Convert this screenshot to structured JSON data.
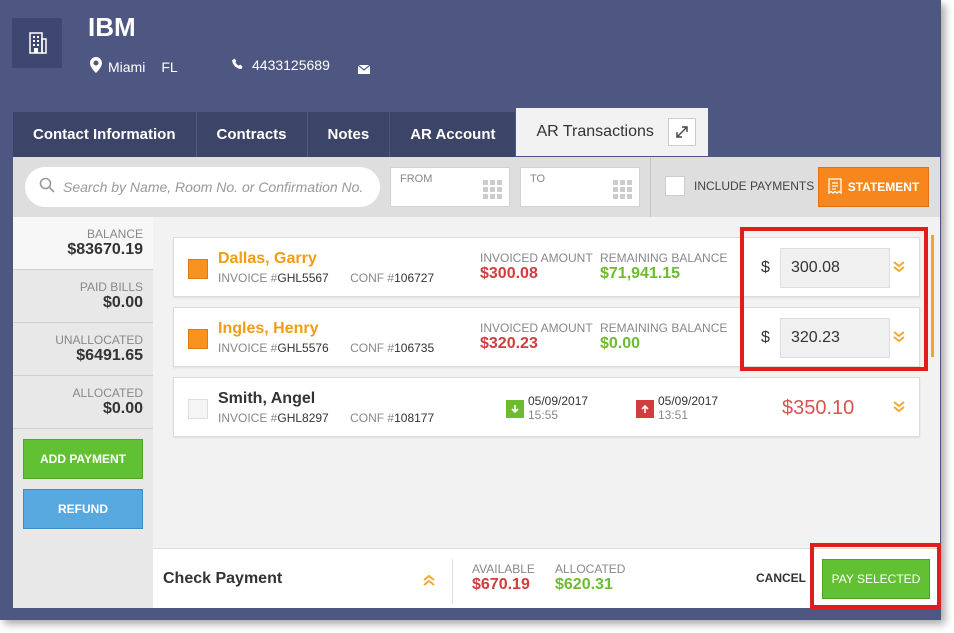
{
  "header": {
    "company": "IBM",
    "city": "Miami",
    "state": "FL",
    "phone": "4433125689",
    "icons": {
      "company": "building-icon",
      "location": "map-pin-icon",
      "phone": "phone-icon",
      "email": "envelope-icon"
    }
  },
  "tabs": [
    {
      "label": "Contact Information",
      "active": false
    },
    {
      "label": "Contracts",
      "active": false
    },
    {
      "label": "Notes",
      "active": false
    },
    {
      "label": "AR Account",
      "active": false
    },
    {
      "label": "AR Transactions",
      "active": true
    }
  ],
  "filters": {
    "search_placeholder": "Search by Name, Room No. or Confirmation No.",
    "from_label": "FROM",
    "to_label": "TO",
    "include_payments_label": "INCLUDE PAYMENTS",
    "include_payments_checked": false,
    "statement_label": "STATEMENT"
  },
  "sidebar": {
    "balance": {
      "label": "BALANCE",
      "value": "$83670.19"
    },
    "paid_bills": {
      "label": "PAID BILLS",
      "value": "$0.00"
    },
    "unallocated": {
      "label": "UNALLOCATED",
      "value": "$6491.65"
    },
    "allocated": {
      "label": "ALLOCATED",
      "value": "$0.00"
    },
    "add_payment_label": "ADD PAYMENT",
    "refund_label": "REFUND"
  },
  "invoices": [
    {
      "name": "Dallas, Garry",
      "selected": true,
      "invoice_prefix": "INVOICE #",
      "invoice_no": "GHL5567",
      "conf_prefix": "CONF #",
      "conf_no": "106727",
      "invoiced_label": "INVOICED AMOUNT",
      "invoiced_amount": "$300.08",
      "remaining_label": "REMAINING BALANCE",
      "remaining_balance": "$71,941.15",
      "currency": "$",
      "payment_amount": "300.08"
    },
    {
      "name": "Ingles, Henry",
      "selected": true,
      "invoice_prefix": "INVOICE #",
      "invoice_no": "GHL5576",
      "conf_prefix": "CONF #",
      "conf_no": "106735",
      "invoiced_label": "INVOICED AMOUNT",
      "invoiced_amount": "$320.23",
      "remaining_label": "REMAINING BALANCE",
      "remaining_balance": "$0.00",
      "currency": "$",
      "payment_amount": "320.23"
    },
    {
      "name": "Smith, Angel",
      "selected": false,
      "invoice_prefix": "INVOICE #",
      "invoice_no": "GHL8297",
      "conf_prefix": "CONF #",
      "conf_no": "108177",
      "arrival_date": "05/09/2017",
      "arrival_time": "15:55",
      "departure_date": "05/09/2017",
      "departure_time": "13:51",
      "amount": "$350.10"
    }
  ],
  "footer": {
    "title": "Check Payment",
    "available_label": "AVAILABLE",
    "available_value": "$670.19",
    "allocated_label": "ALLOCATED",
    "allocated_value": "$620.31",
    "cancel_label": "CANCEL",
    "pay_selected_label": "PAY SELECTED"
  },
  "colors": {
    "header_bg": "#4e5782",
    "accent_orange": "#f7861c",
    "green": "#61c132",
    "blue": "#58a8e0",
    "red": "#d23c3c",
    "highlight_red": "#e01d1d"
  }
}
